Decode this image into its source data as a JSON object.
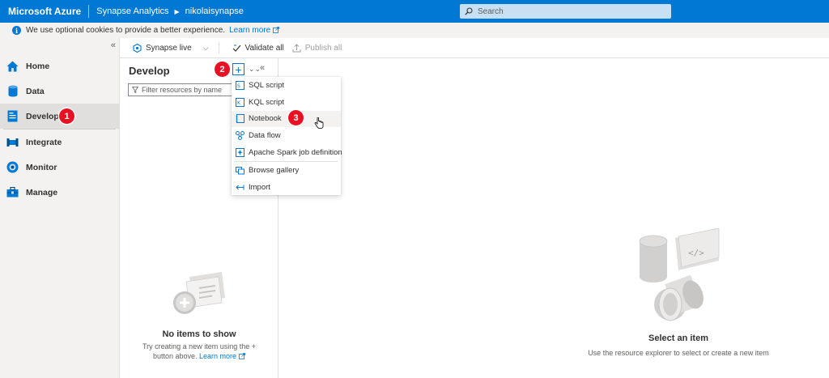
{
  "topbar": {
    "brand": "Microsoft Azure",
    "crumb1": "Synapse Analytics",
    "crumb2": "nikolaisynapse",
    "search_placeholder": "Search"
  },
  "cookie": {
    "message": "We use optional cookies to provide a better experience.",
    "link": "Learn more"
  },
  "sidebar": {
    "items": [
      {
        "label": "Home",
        "icon": "home-icon"
      },
      {
        "label": "Data",
        "icon": "database-icon"
      },
      {
        "label": "Develop",
        "icon": "document-icon",
        "active": true
      },
      {
        "label": "Integrate",
        "icon": "pipeline-icon"
      },
      {
        "label": "Monitor",
        "icon": "monitor-icon"
      },
      {
        "label": "Manage",
        "icon": "toolbox-icon"
      }
    ]
  },
  "toolbar": {
    "synapse_live": "Synapse live",
    "validate_all": "Validate all",
    "publish_all": "Publish all"
  },
  "develop": {
    "title": "Develop",
    "filter_placeholder": "Filter resources by name",
    "empty_title": "No items to show",
    "empty_desc": "Try creating a new item using the + button above.",
    "empty_link": "Learn more"
  },
  "menu": {
    "items": [
      {
        "label": "SQL script",
        "icon": "sql-script-icon"
      },
      {
        "label": "KQL script",
        "icon": "kql-script-icon"
      },
      {
        "label": "Notebook",
        "icon": "notebook-icon"
      },
      {
        "label": "Data flow",
        "icon": "dataflow-icon"
      },
      {
        "label": "Apache Spark job definition",
        "icon": "spark-job-icon"
      },
      {
        "label": "Browse gallery",
        "icon": "gallery-icon"
      },
      {
        "label": "Import",
        "icon": "import-icon"
      }
    ]
  },
  "badges": {
    "b1": "1",
    "b2": "2",
    "b3": "3"
  },
  "main": {
    "title": "Select an item",
    "desc": "Use the resource explorer to select or create a new item"
  },
  "colors": {
    "accent": "#0078d4",
    "badge": "#e81123"
  }
}
